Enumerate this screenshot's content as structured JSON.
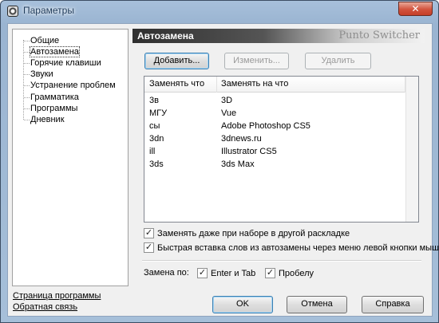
{
  "window": {
    "title": "Параметры",
    "close_label": "✕"
  },
  "nav": {
    "items": [
      "Общие",
      "Автозамена",
      "Горячие клавиши",
      "Звуки",
      "Устранение проблем",
      "Грамматика",
      "Программы",
      "Дневник"
    ],
    "selected": "Автозамена"
  },
  "panel": {
    "title": "Автозамена",
    "brand": "Punto Switcher",
    "buttons": {
      "add": "Добавить...",
      "edit": "Изменить...",
      "delete": "Удалить"
    }
  },
  "table": {
    "columns": [
      "Заменять что",
      "Заменять на что"
    ],
    "rows": [
      [
        "3в",
        "3D"
      ],
      [
        "МГУ",
        "Vue"
      ],
      [
        "сы",
        "Adobe Photoshop CS5"
      ],
      [
        "3dn",
        "3dnews.ru"
      ],
      [
        "ill",
        "Illustrator CS5"
      ],
      [
        "3ds",
        "3ds Max"
      ]
    ]
  },
  "options": {
    "replace_other_layout": {
      "label": "Заменять даже при наборе в другой раскладке",
      "checked": true
    },
    "quick_insert": {
      "label": "Быстрая вставка слов из автозамены через меню левой кнопки мыши",
      "checked": true
    }
  },
  "replace_on": {
    "label": "Замена по:",
    "enter_tab": {
      "label": "Enter и Tab",
      "checked": true
    },
    "space": {
      "label": "Пробелу",
      "checked": true
    }
  },
  "links": {
    "program_page": "Страница программы",
    "feedback": "Обратная связь"
  },
  "footer_buttons": {
    "ok": "OK",
    "cancel": "Отмена",
    "help": "Справка"
  },
  "glyphs": {
    "check": "✓"
  }
}
